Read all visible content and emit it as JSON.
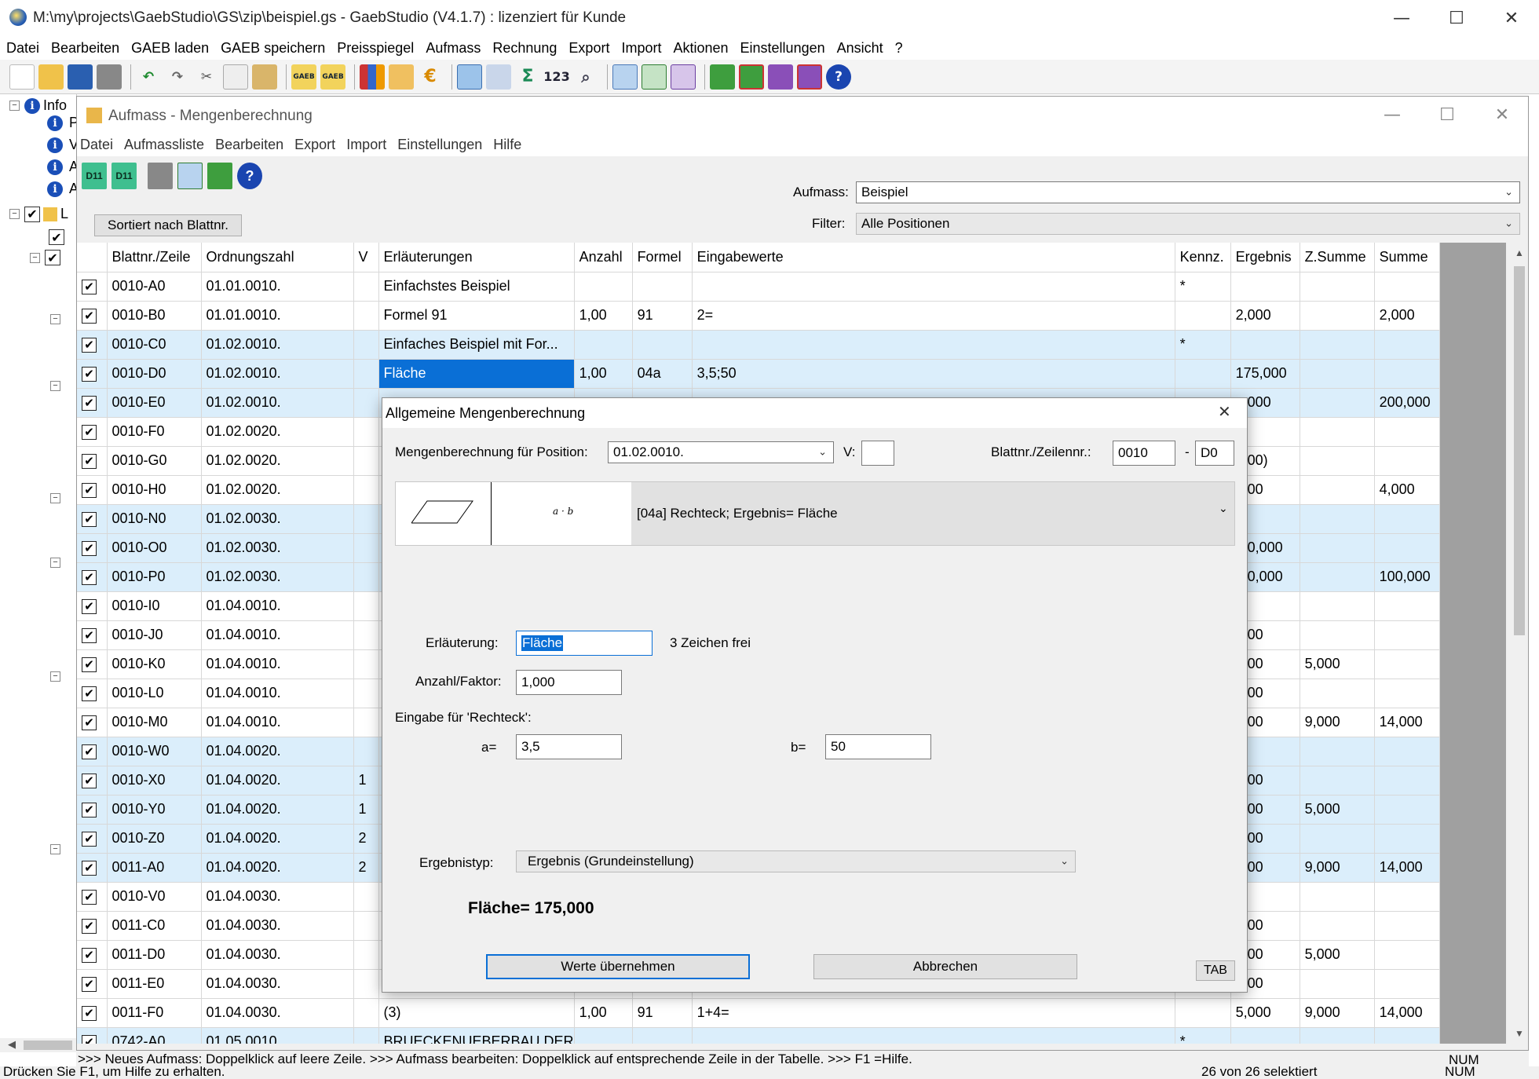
{
  "app": {
    "title": "M:\\my\\projects\\GaebStudio\\GS\\zip\\beispiel.gs - GaebStudio (V4.1.7) : lizenziert für Kunde"
  },
  "window_controls": {
    "minimize": "—",
    "maximize": "☐",
    "close": "✕"
  },
  "menu": [
    "Datei",
    "Bearbeiten",
    "GAEB laden",
    "GAEB speichern",
    "Preisspiegel",
    "Aufmass",
    "Rechnung",
    "Export",
    "Import",
    "Aktionen",
    "Einstellungen",
    "Ansicht",
    "?"
  ],
  "toolbar": {
    "gaeb_label": "GAEB",
    "sigma": "Σ",
    "numbers": "123",
    "help": "?"
  },
  "tree": {
    "root_label": "Info",
    "child_letters": [
      "P",
      "V",
      "A",
      "A"
    ],
    "lv_label": "L"
  },
  "child": {
    "title": "Aufmass - Mengenberechnung",
    "menu": [
      "Datei",
      "Aufmassliste",
      "Bearbeiten",
      "Export",
      "Import",
      "Einstellungen",
      "Hilfe"
    ],
    "toolbar": {
      "d11a": "D11",
      "d11b": "D11",
      "help": "?"
    },
    "sort_button": "Sortiert nach Blattnr.",
    "aufmass_label": "Aufmass:",
    "aufmass_value": "Beispiel",
    "filter_label": "Filter:",
    "filter_value": "Alle Positionen"
  },
  "grid": {
    "columns": [
      "",
      "Blattnr./Zeile",
      "Ordnungszahl",
      "V",
      "Erläuterungen",
      "Anzahl",
      "Formel",
      "Eingabewerte",
      "Kennz.",
      "Ergebnis",
      "Z.Summe",
      "Summe"
    ],
    "rows": [
      {
        "c": "✔",
        "blatt": "0010-A0",
        "oz": "01.01.0010.",
        "v": "",
        "erl": "Einfachstes Beispiel",
        "anz": "",
        "formel": "",
        "eing": "",
        "kennz": "*",
        "erg": "",
        "zs": "",
        "sum": "",
        "hl": false
      },
      {
        "c": "✔",
        "blatt": "0010-B0",
        "oz": "01.01.0010.",
        "v": "",
        "erl": "Formel 91",
        "anz": "1,00",
        "formel": "91",
        "eing": "2=",
        "kennz": "",
        "erg": "2,000",
        "zs": "",
        "sum": "2,000",
        "hl": false
      },
      {
        "c": "✔",
        "blatt": "0010-C0",
        "oz": "01.02.0010.",
        "v": "",
        "erl": "Einfaches Beispiel mit For...",
        "anz": "",
        "formel": "",
        "eing": "",
        "kennz": "*",
        "erg": "",
        "zs": "",
        "sum": "",
        "hl": true
      },
      {
        "c": "✔",
        "blatt": "0010-D0",
        "oz": "01.02.0010.",
        "v": "",
        "erl": "Fläche",
        "anz": "1,00",
        "formel": "04a",
        "eing": "3,5;50",
        "kennz": "",
        "erg": "175,000",
        "zs": "",
        "sum": "",
        "hl": true,
        "sel": true
      },
      {
        "c": "✔",
        "blatt": "0010-E0",
        "oz": "01.02.0010.",
        "v": "",
        "erl": "",
        "anz": "",
        "formel": "",
        "eing": "",
        "kennz": "",
        "erg": "...000",
        "zs": "",
        "sum": "200,000",
        "hl": true
      },
      {
        "c": "✔",
        "blatt": "0010-F0",
        "oz": "01.02.0020.",
        "v": "",
        "erl": "",
        "anz": "",
        "formel": "",
        "eing": "",
        "kennz": "",
        "erg": "",
        "zs": "",
        "sum": "",
        "hl": false
      },
      {
        "c": "✔",
        "blatt": "0010-G0",
        "oz": "01.02.0020.",
        "v": "",
        "erl": "",
        "anz": "",
        "formel": "",
        "eing": "",
        "kennz": "",
        "erg": "...00)",
        "zs": "",
        "sum": "",
        "hl": false
      },
      {
        "c": "✔",
        "blatt": "0010-H0",
        "oz": "01.02.0020.",
        "v": "",
        "erl": "",
        "anz": "",
        "formel": "",
        "eing": "",
        "kennz": "",
        "erg": "...00",
        "zs": "",
        "sum": "4,000",
        "hl": false
      },
      {
        "c": "✔",
        "blatt": "0010-N0",
        "oz": "01.02.0030.",
        "v": "",
        "erl": "",
        "anz": "",
        "formel": "",
        "eing": "",
        "kennz": "",
        "erg": "",
        "zs": "",
        "sum": "",
        "hl": true
      },
      {
        "c": "✔",
        "blatt": "0010-O0",
        "oz": "01.02.0030.",
        "v": "",
        "erl": "",
        "anz": "",
        "formel": "",
        "eing": "",
        "kennz": "",
        "erg": "...0,000",
        "zs": "",
        "sum": "",
        "hl": true
      },
      {
        "c": "✔",
        "blatt": "0010-P0",
        "oz": "01.02.0030.",
        "v": "",
        "erl": "",
        "anz": "",
        "formel": "",
        "eing": "",
        "kennz": "",
        "erg": "...0,000",
        "zs": "",
        "sum": "100,000",
        "hl": true
      },
      {
        "c": "✔",
        "blatt": "0010-I0",
        "oz": "01.04.0010.",
        "v": "",
        "erl": "",
        "anz": "",
        "formel": "",
        "eing": "",
        "kennz": "",
        "erg": "",
        "zs": "",
        "sum": "",
        "hl": false
      },
      {
        "c": "✔",
        "blatt": "0010-J0",
        "oz": "01.04.0010.",
        "v": "",
        "erl": "",
        "anz": "",
        "formel": "",
        "eing": "",
        "kennz": "",
        "erg": "...00",
        "zs": "",
        "sum": "",
        "hl": false
      },
      {
        "c": "✔",
        "blatt": "0010-K0",
        "oz": "01.04.0010.",
        "v": "",
        "erl": "",
        "anz": "",
        "formel": "",
        "eing": "",
        "kennz": "",
        "erg": "...00",
        "zs": "5,000",
        "sum": "",
        "hl": false
      },
      {
        "c": "✔",
        "blatt": "0010-L0",
        "oz": "01.04.0010.",
        "v": "",
        "erl": "",
        "anz": "",
        "formel": "",
        "eing": "",
        "kennz": "",
        "erg": "...00",
        "zs": "",
        "sum": "",
        "hl": false
      },
      {
        "c": "✔",
        "blatt": "0010-M0",
        "oz": "01.04.0010.",
        "v": "",
        "erl": "",
        "anz": "",
        "formel": "",
        "eing": "",
        "kennz": "",
        "erg": "...00",
        "zs": "9,000",
        "sum": "14,000",
        "hl": false
      },
      {
        "c": "✔",
        "blatt": "0010-W0",
        "oz": "01.04.0020.",
        "v": "",
        "erl": "",
        "anz": "",
        "formel": "",
        "eing": "",
        "kennz": "",
        "erg": "",
        "zs": "",
        "sum": "",
        "hl": true
      },
      {
        "c": "✔",
        "blatt": "0010-X0",
        "oz": "01.04.0020.",
        "v": "1",
        "erl": "",
        "anz": "",
        "formel": "",
        "eing": "",
        "kennz": "",
        "erg": "...00",
        "zs": "",
        "sum": "",
        "hl": true
      },
      {
        "c": "✔",
        "blatt": "0010-Y0",
        "oz": "01.04.0020.",
        "v": "1",
        "erl": "",
        "anz": "",
        "formel": "",
        "eing": "",
        "kennz": "",
        "erg": "...00",
        "zs": "5,000",
        "sum": "",
        "hl": true
      },
      {
        "c": "✔",
        "blatt": "0010-Z0",
        "oz": "01.04.0020.",
        "v": "2",
        "erl": "",
        "anz": "",
        "formel": "",
        "eing": "",
        "kennz": "",
        "erg": "...00",
        "zs": "",
        "sum": "",
        "hl": true
      },
      {
        "c": "✔",
        "blatt": "0011-A0",
        "oz": "01.04.0020.",
        "v": "2",
        "erl": "",
        "anz": "",
        "formel": "",
        "eing": "",
        "kennz": "",
        "erg": "...00",
        "zs": "9,000",
        "sum": "14,000",
        "hl": true
      },
      {
        "c": "✔",
        "blatt": "0010-V0",
        "oz": "01.04.0030.",
        "v": "",
        "erl": "",
        "anz": "",
        "formel": "",
        "eing": "",
        "kennz": "",
        "erg": "",
        "zs": "",
        "sum": "",
        "hl": false
      },
      {
        "c": "✔",
        "blatt": "0011-C0",
        "oz": "01.04.0030.",
        "v": "",
        "erl": "",
        "anz": "",
        "formel": "",
        "eing": "",
        "kennz": "",
        "erg": "...00",
        "zs": "",
        "sum": "",
        "hl": false
      },
      {
        "c": "✔",
        "blatt": "0011-D0",
        "oz": "01.04.0030.",
        "v": "",
        "erl": "",
        "anz": "",
        "formel": "",
        "eing": "",
        "kennz": "",
        "erg": "...00",
        "zs": "5,000",
        "sum": "",
        "hl": false
      },
      {
        "c": "✔",
        "blatt": "0011-E0",
        "oz": "01.04.0030.",
        "v": "",
        "erl": "",
        "anz": "",
        "formel": "",
        "eing": "",
        "kennz": "",
        "erg": "...00",
        "zs": "",
        "sum": "",
        "hl": false
      },
      {
        "c": "✔",
        "blatt": "0011-F0",
        "oz": "01.04.0030.",
        "v": "",
        "erl": "(3)",
        "anz": "1,00",
        "formel": "91",
        "eing": "1+4=",
        "kennz": "",
        "erg": "5,000",
        "zs": "9,000",
        "sum": "14,000",
        "hl": false
      },
      {
        "c": "✔",
        "blatt": "0742-A0",
        "oz": "01.05.0010.",
        "v": "",
        "erl": "BRUECKENUEBERBAU DER",
        "anz": "",
        "formel": "",
        "eing": "",
        "kennz": "*",
        "erg": "",
        "zs": "",
        "sum": "",
        "hl": true
      }
    ]
  },
  "status": {
    "hint": ">>> Neues Aufmass: Doppelklick auf leere Zeile. >>> Aufmass bearbeiten: Doppelklick auf entsprechende Zeile in der Tabelle.  >>> F1 =Hilfe.",
    "num": "NUM",
    "main_left": "Drücken Sie F1, um Hilfe zu erhalten.",
    "main_right": "26 von 26 selektiert",
    "main_num": "NUM"
  },
  "dialog": {
    "title": "Allgemeine Mengenberechnung",
    "close": "✕",
    "position_label": "Mengenberechnung für Position:",
    "position_value": "01.02.0010.",
    "v_label": "V:",
    "v_value": "",
    "blatt_label": "Blattnr./Zeilennr.:",
    "blatt_value": "0010",
    "dash": "-",
    "zeile_value": "D0",
    "formula_preview_text": "a · b",
    "formula_desc": "[04a] Rechteck; Ergebnis= Fläche",
    "erl_label": "Erläuterung:",
    "erl_value": "Fläche",
    "chars_free": "3 Zeichen frei",
    "anzahl_label": "Anzahl/Faktor:",
    "anzahl_value": "1,000",
    "eingabe_label": "Eingabe für 'Rechteck':",
    "a_label": "a=",
    "a_value": "3,5",
    "b_label": "b=",
    "b_value": "50",
    "ergebnistyp_label": "Ergebnistyp:",
    "ergebnistyp_value": "Ergebnis (Grundeinstellung)",
    "result_text": "Fläche= 175,000",
    "ok_button": "Werte übernehmen",
    "cancel_button": "Abbrechen",
    "tab_button": "TAB"
  }
}
